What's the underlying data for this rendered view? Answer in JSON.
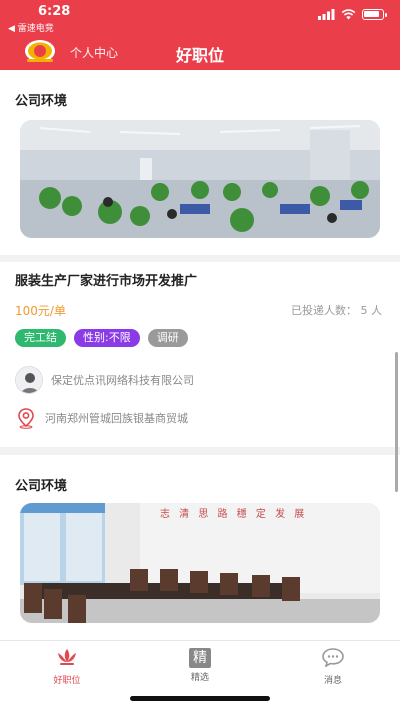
{
  "status_bar": {
    "time": "6:28",
    "back_label": "◀ 雷速电竞"
  },
  "nav": {
    "personal_center": "个人中心",
    "title": "好职位"
  },
  "sections": {
    "env1_title": "公司环境",
    "env2_title": "公司环境"
  },
  "job": {
    "title": "服装生产厂家进行市场开发推广",
    "price": "100元/单",
    "applied_text": "已投递人数： 5 人",
    "tags": [
      {
        "label": "完工结",
        "color": "#2fb86f"
      },
      {
        "label": "性别:不限",
        "color": "#8a3be6"
      },
      {
        "label": "调研",
        "color": "#9a9a9a"
      }
    ],
    "company": "保定优点讯网络科技有限公司",
    "address": "河南郑州管城回族银基商贸城"
  },
  "photo2_banner": "志 清 思 路   穩 定 发 展",
  "tabbar": {
    "items": [
      {
        "label": "好职位",
        "icon": "lotus-icon",
        "active": true
      },
      {
        "label": "精选",
        "icon": "jing-icon",
        "glyph": "精",
        "active": false
      },
      {
        "label": "消息",
        "icon": "chat-bubble-icon",
        "active": false
      }
    ]
  },
  "colors": {
    "accent": "#ea3f4b",
    "price": "#f19a2e"
  }
}
